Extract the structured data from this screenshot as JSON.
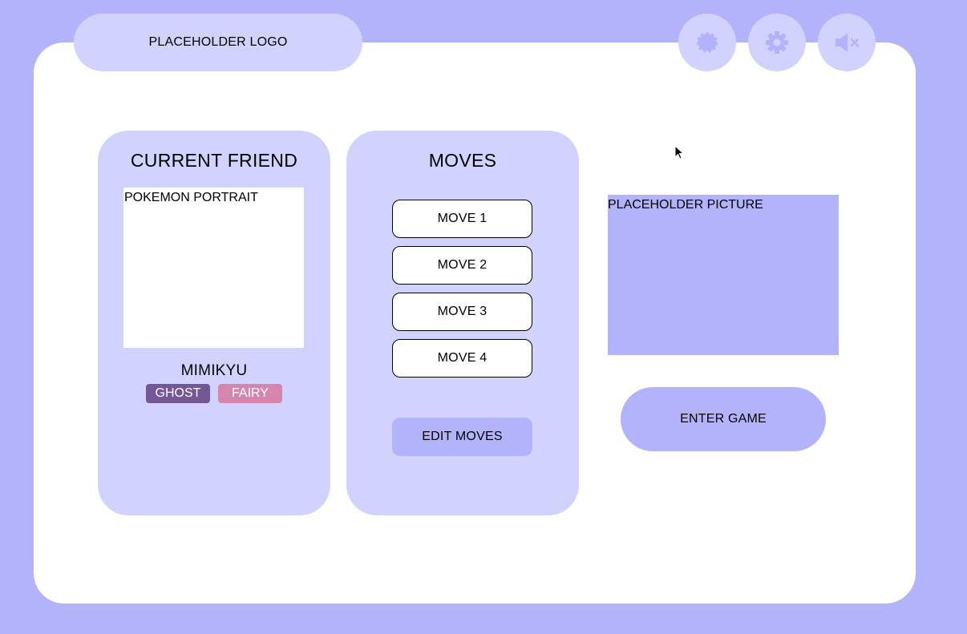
{
  "header": {
    "logo_label": "PLACEHOLDER LOGO",
    "icons": [
      "badge-icon",
      "gear-icon",
      "mute-icon"
    ]
  },
  "friend_card": {
    "title": "CURRENT FRIEND",
    "portrait_label": "POKEMON PORTRAIT",
    "name": "MIMIKYU",
    "types": [
      {
        "label": "GHOST",
        "color": "#735797"
      },
      {
        "label": "FAIRY",
        "color": "#d685ad"
      }
    ]
  },
  "moves_card": {
    "title": "MOVES",
    "moves": [
      "MOVE 1",
      "MOVE 2",
      "MOVE 3",
      "MOVE 4"
    ],
    "edit_label": "EDIT MOVES"
  },
  "preview": {
    "picture_label": "PLACEHOLDER PICTURE",
    "enter_label": "ENTER GAME"
  },
  "colors": {
    "background": "#b3b3fc",
    "panel": "#ffffff",
    "card": "#d2d2fe",
    "accent": "#b3b3fc"
  }
}
